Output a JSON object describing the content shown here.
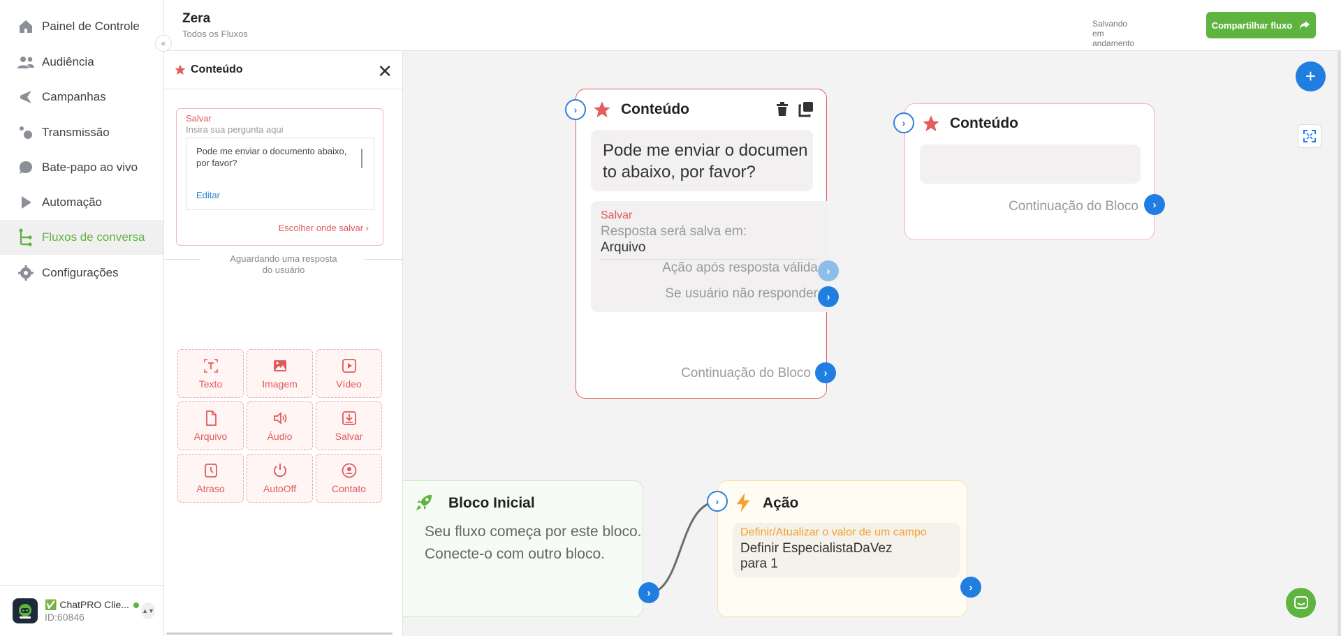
{
  "app": {
    "flow_title": "Zera",
    "flow_subtitle": "Todos os Fluxos",
    "saving_status": "Salvando em andamento",
    "share_label": "Compartilhar fluxo"
  },
  "sidebar": {
    "items": [
      {
        "label": "Painel de Controle",
        "icon": "home-icon"
      },
      {
        "label": "Audiência",
        "icon": "users-icon"
      },
      {
        "label": "Campanhas",
        "icon": "campaign-icon"
      },
      {
        "label": "Transmissão",
        "icon": "broadcast-icon"
      },
      {
        "label": "Bate-papo ao vivo",
        "icon": "chat-icon"
      },
      {
        "label": "Automação",
        "icon": "automation-icon"
      },
      {
        "label": "Fluxos de conversa",
        "icon": "flow-icon",
        "active": true
      },
      {
        "label": "Configurações",
        "icon": "gear-icon"
      }
    ],
    "account": {
      "name": "ChatPRO Clie...",
      "id": "ID:60846",
      "check": "✅"
    }
  },
  "panel": {
    "title": "Conteúdo",
    "save_label": "Salvar",
    "question_placeholder": "Insira sua pergunta aqui",
    "question_text": "Pode me enviar o documento abaixo, por favor?",
    "edit_label": "Editar",
    "choose_label": "Escolher onde salvar",
    "waiting_text": "Aguardando uma resposta do usuário",
    "buttons": [
      {
        "label": "Texto",
        "icon": "text-icon"
      },
      {
        "label": "Imagem",
        "icon": "image-icon"
      },
      {
        "label": "Vídeo",
        "icon": "video-icon"
      },
      {
        "label": "Arquivo",
        "icon": "file-icon"
      },
      {
        "label": "Áudio",
        "icon": "audio-icon"
      },
      {
        "label": "Salvar",
        "icon": "save-icon"
      },
      {
        "label": "Atraso",
        "icon": "delay-icon"
      },
      {
        "label": "AutoOff",
        "icon": "power-icon"
      },
      {
        "label": "Contato",
        "icon": "contact-icon"
      }
    ]
  },
  "canvas": {
    "content_node": {
      "title": "Conteúdo",
      "message_line1": "Pode me enviar o documen",
      "message_line2": "to abaixo, por favor?",
      "save_label": "Salvar",
      "save_desc": "Resposta será salva em:",
      "save_target": "Arquivo",
      "valid_action": "Ação após resposta válida",
      "no_response": "Se usuário não responder",
      "continuation": "Continuação do Bloco"
    },
    "content_node_2": {
      "title": "Conteúdo",
      "continuation": "Continuação do Bloco"
    },
    "start_node": {
      "title": "Bloco Inicial",
      "line1": "Seu fluxo começa por este bloco.",
      "line2": "Conecte-o com outro bloco."
    },
    "action_node": {
      "title": "Ação",
      "label": "Definir/Atualizar o valor de um campo",
      "line1": "Definir EspecialistaDaVez",
      "line2": "para 1"
    }
  },
  "colors": {
    "brand_green": "#5fb43f",
    "accent_blue": "#1f7ee0",
    "content_red": "#e35d5d",
    "action_orange": "#f2a22e"
  }
}
